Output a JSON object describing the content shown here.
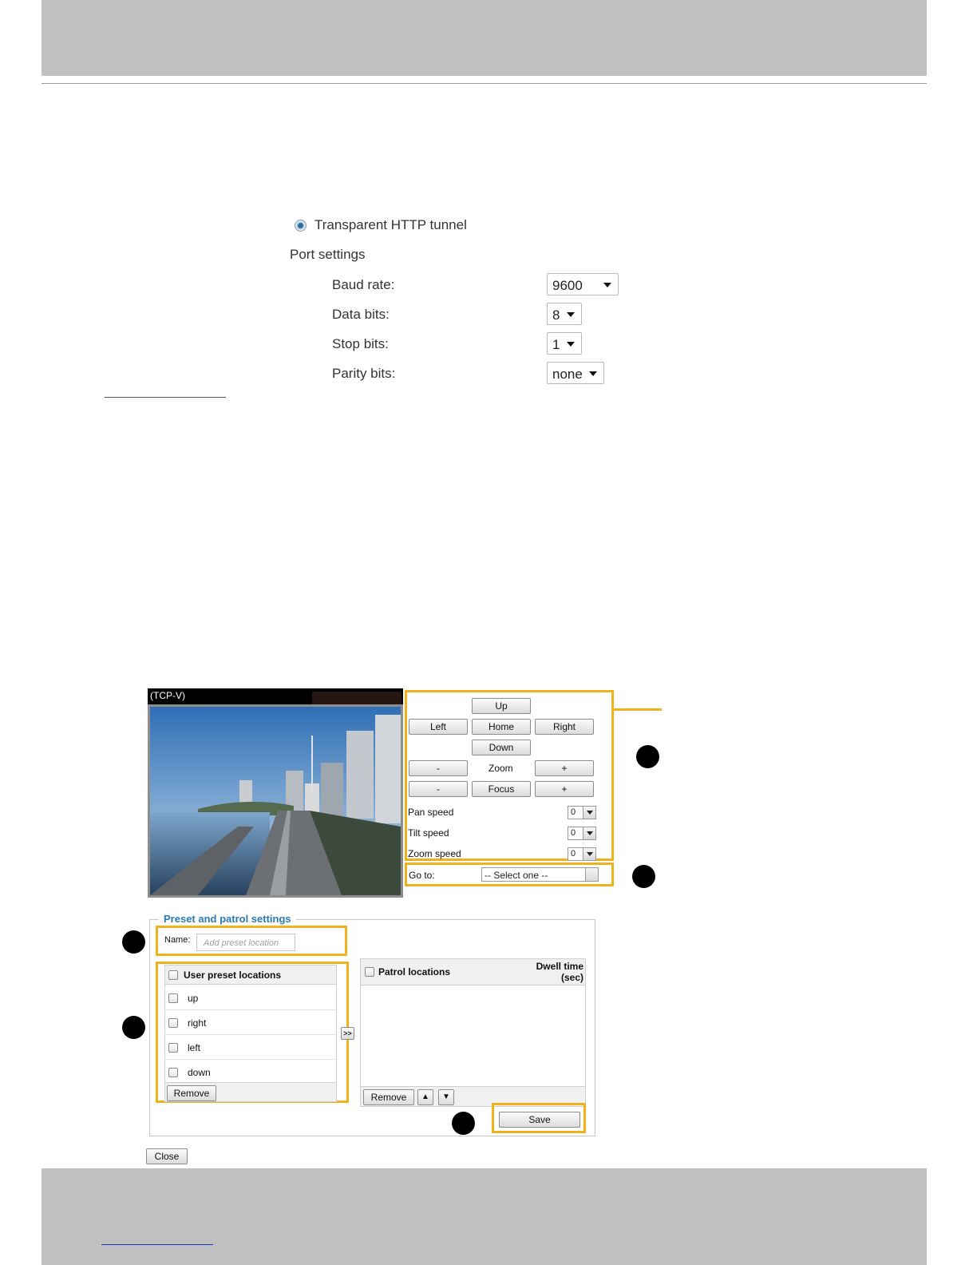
{
  "serial": {
    "mode_label": "Transparent HTTP tunnel",
    "port_settings_heading": "Port settings",
    "rows": [
      {
        "label": "Baud rate:",
        "value": "9600"
      },
      {
        "label": "Data bits:",
        "value": "8"
      },
      {
        "label": "Stop bits:",
        "value": "1"
      },
      {
        "label": "Parity bits:",
        "value": "none"
      }
    ]
  },
  "camera": {
    "title": "(TCP-V)"
  },
  "ptz": {
    "up": "Up",
    "left": "Left",
    "home": "Home",
    "right": "Right",
    "down": "Down",
    "zoom_minus": "-",
    "zoom_label": "Zoom",
    "zoom_plus": "+",
    "focus_minus": "-",
    "focus_label": "Focus",
    "focus_plus": "+",
    "pan_speed_label": "Pan speed",
    "pan_speed_value": "0",
    "tilt_speed_label": "Tilt speed",
    "tilt_speed_value": "0",
    "zoom_speed_label": "Zoom speed",
    "zoom_speed_value": "0",
    "goto_label": "Go to:",
    "goto_value": "-- Select one --"
  },
  "preset": {
    "legend": "Preset and patrol settings",
    "name_label": "Name:",
    "name_placeholder": "Add preset location",
    "user_header": "User preset locations",
    "user_items": [
      "up",
      "right",
      "left",
      "down"
    ],
    "remove_label": "Remove",
    "move_label": ">>",
    "patrol_header": "Patrol locations",
    "dwell_line1": "Dwell time",
    "dwell_line2": "(sec)",
    "patrol_remove_label": "Remove",
    "up_arrow": "▲",
    "down_arrow": "▼",
    "save_label": "Save",
    "close_label": "Close"
  },
  "colors": {
    "highlight": "#efb21c",
    "legend": "#2c7bb6",
    "band": "#c0c0c0"
  }
}
